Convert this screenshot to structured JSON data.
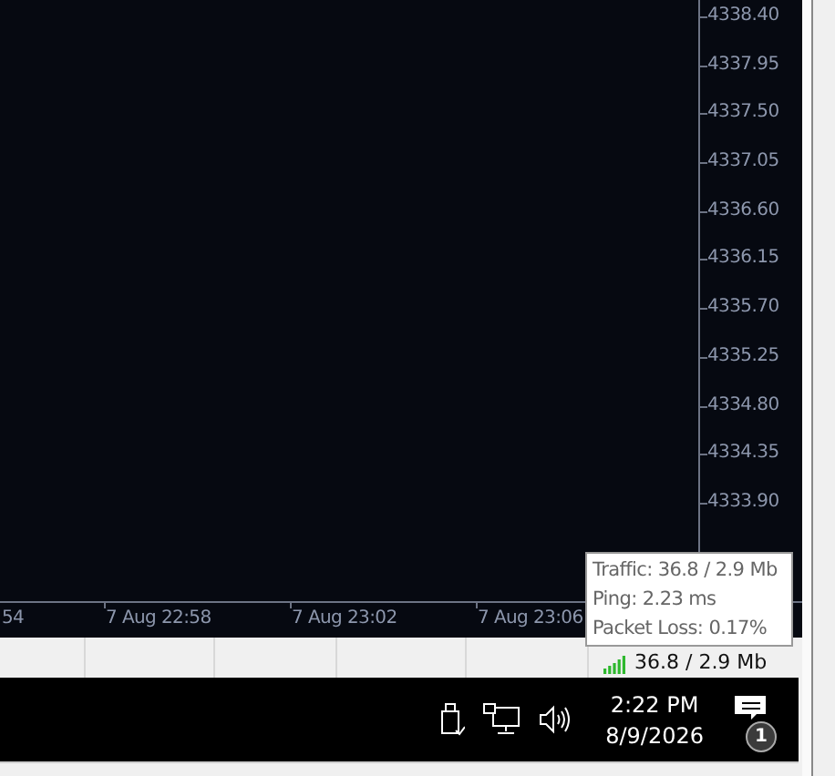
{
  "chart": {
    "price_axis": [
      "4338.40",
      "4337.95",
      "4337.50",
      "4337.05",
      "4336.60",
      "4336.15",
      "4335.70",
      "4335.25",
      "4334.80",
      "4334.35",
      "4333.90"
    ],
    "time_axis": [
      "54",
      "7 Aug 22:58",
      "7 Aug 23:02",
      "7 Aug 23:06"
    ]
  },
  "tooltip": {
    "lines": [
      "Traffic: 36.8 / 2.9 Mb",
      "Ping: 2.23 ms",
      "Packet Loss: 0.17%"
    ]
  },
  "status_bar": {
    "traffic": "36.8 / 2.9 Mb"
  },
  "taskbar": {
    "time": "2:22 PM",
    "date": "8/9/2026",
    "notification_count": "1"
  }
}
